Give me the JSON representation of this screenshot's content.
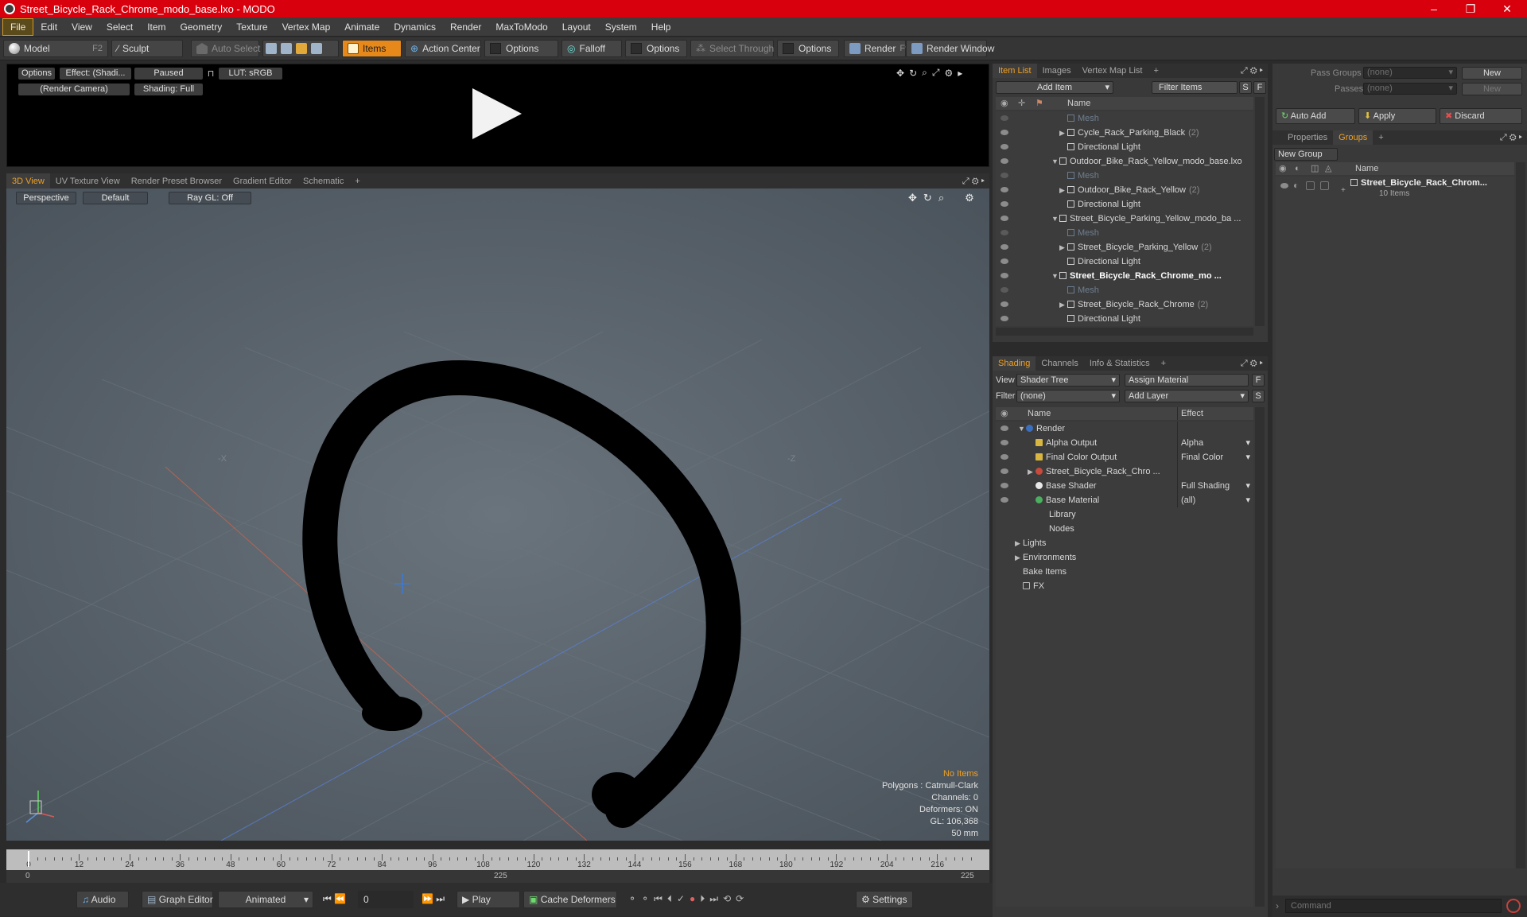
{
  "window": {
    "title": "Street_Bicycle_Rack_Chrome_modo_base.lxo - MODO",
    "minimize": "–",
    "maximize": "❐",
    "close": "✕"
  },
  "menu": [
    "File",
    "Edit",
    "View",
    "Select",
    "Item",
    "Geometry",
    "Texture",
    "Vertex Map",
    "Animate",
    "Dynamics",
    "Render",
    "MaxToModo",
    "Layout",
    "System",
    "Help"
  ],
  "toolbar": {
    "model": "Model",
    "model_key": "F2",
    "sculpt": "Sculpt",
    "auto_select": "Auto Select",
    "items": "Items",
    "action_center": "Action Center",
    "options1": "Options",
    "falloff": "Falloff",
    "options2": "Options",
    "select_through": "Select Through",
    "options3": "Options",
    "render": "Render",
    "render_key": "F9",
    "render_window": "Render Window"
  },
  "preview": {
    "options": "Options",
    "effect": "Effect: (Shadi...",
    "paused": "Paused",
    "lut": "LUT: sRGB",
    "camera": "(Render Camera)",
    "shading": "Shading: Full"
  },
  "viewport_tabs": [
    "3D View",
    "UV Texture View",
    "Render Preset Browser",
    "Gradient Editor",
    "Schematic",
    "+"
  ],
  "viewport": {
    "perspective": "Perspective",
    "default": "Default",
    "raygl": "Ray GL: Off",
    "axis_x": "-X",
    "axis_z": "-Z",
    "stats": {
      "no_items": "No Items",
      "polygons": "Polygons : Catmull-Clark",
      "channels": "Channels: 0",
      "deformers": "Deformers: ON",
      "gl": "GL: 106,368",
      "mm": "50 mm"
    }
  },
  "timeline": {
    "ticks": [
      "0",
      "12",
      "24",
      "36",
      "48",
      "60",
      "72",
      "84",
      "96",
      "108",
      "120",
      "132",
      "144",
      "156",
      "168",
      "180",
      "192",
      "204",
      "216"
    ],
    "start": "0",
    "mid": "225",
    "end": "225"
  },
  "bottom": {
    "audio": "Audio",
    "graph_editor": "Graph Editor",
    "animated": "Animated",
    "frame": "0",
    "play": "Play",
    "cache_deformers": "Cache Deformers",
    "settings": "Settings"
  },
  "item_list": {
    "tabs": [
      "Item List",
      "Images",
      "Vertex Map List",
      "+"
    ],
    "add_item": "Add Item",
    "filter_items": "Filter Items",
    "s": "S",
    "f": "F",
    "name_header": "Name",
    "rows": [
      {
        "label": "Mesh",
        "count": "",
        "bold": false,
        "dim": true,
        "indent": 3
      },
      {
        "label": "Cycle_Rack_Parking_Black",
        "count": "(2)",
        "bold": false,
        "dim": false,
        "indent": 3
      },
      {
        "label": "Directional Light",
        "count": "",
        "bold": false,
        "dim": false,
        "indent": 3
      },
      {
        "label": "Outdoor_Bike_Rack_Yellow_modo_base.lxo",
        "count": "",
        "bold": false,
        "dim": false,
        "indent": 2
      },
      {
        "label": "Mesh",
        "count": "",
        "bold": false,
        "dim": true,
        "indent": 3
      },
      {
        "label": "Outdoor_Bike_Rack_Yellow",
        "count": "(2)",
        "bold": false,
        "dim": false,
        "indent": 3
      },
      {
        "label": "Directional Light",
        "count": "",
        "bold": false,
        "dim": false,
        "indent": 3
      },
      {
        "label": "Street_Bicycle_Parking_Yellow_modo_ba ...",
        "count": "",
        "bold": false,
        "dim": false,
        "indent": 2
      },
      {
        "label": "Mesh",
        "count": "",
        "bold": false,
        "dim": true,
        "indent": 3
      },
      {
        "label": "Street_Bicycle_Parking_Yellow",
        "count": "(2)",
        "bold": false,
        "dim": false,
        "indent": 3
      },
      {
        "label": "Directional Light",
        "count": "",
        "bold": false,
        "dim": false,
        "indent": 3
      },
      {
        "label": "Street_Bicycle_Rack_Chrome_mo ...",
        "count": "",
        "bold": true,
        "dim": false,
        "indent": 2
      },
      {
        "label": "Mesh",
        "count": "",
        "bold": false,
        "dim": true,
        "indent": 3
      },
      {
        "label": "Street_Bicycle_Rack_Chrome",
        "count": "(2)",
        "bold": false,
        "dim": false,
        "indent": 3
      },
      {
        "label": "Directional Light",
        "count": "",
        "bold": false,
        "dim": false,
        "indent": 3
      }
    ]
  },
  "shading": {
    "tabs": [
      "Shading",
      "Channels",
      "Info & Statistics",
      "+"
    ],
    "view_label": "View",
    "view_value": "Shader Tree",
    "assign_material": "Assign Material",
    "f": "F",
    "filter_label": "Filter",
    "filter_value": "(none)",
    "add_layer": "Add Layer",
    "s": "S",
    "name_header": "Name",
    "effect_header": "Effect",
    "rows": [
      {
        "label": "Render",
        "effect": ""
      },
      {
        "label": "Alpha Output",
        "effect": "Alpha"
      },
      {
        "label": "Final Color Output",
        "effect": "Final Color"
      },
      {
        "label": "Street_Bicycle_Rack_Chro ...",
        "effect": ""
      },
      {
        "label": "Base Shader",
        "effect": "Full Shading"
      },
      {
        "label": "Base Material",
        "effect": "(all)"
      },
      {
        "label": "Library",
        "effect": ""
      },
      {
        "label": "Nodes",
        "effect": ""
      },
      {
        "label": "Lights",
        "effect": ""
      },
      {
        "label": "Environments",
        "effect": ""
      },
      {
        "label": "Bake Items",
        "effect": ""
      },
      {
        "label": "FX",
        "effect": ""
      }
    ]
  },
  "groups": {
    "pass_groups_label": "Pass Groups",
    "pass_groups_value": "(none)",
    "new1": "New",
    "passes_label": "Passes",
    "passes_value": "(none)",
    "new2": "New",
    "auto_add": "Auto Add",
    "apply": "Apply",
    "discard": "Discard",
    "tabs": [
      "Properties",
      "Groups",
      "+"
    ],
    "new_group": "New Group",
    "name_header": "Name",
    "item_name": "Street_Bicycle_Rack_Chrom...",
    "item_count": "10 Items",
    "command_placeholder": "Command"
  },
  "colors": {
    "accent": "#f0a023",
    "title_bar": "#d8000c",
    "viewport": "#55606a"
  }
}
